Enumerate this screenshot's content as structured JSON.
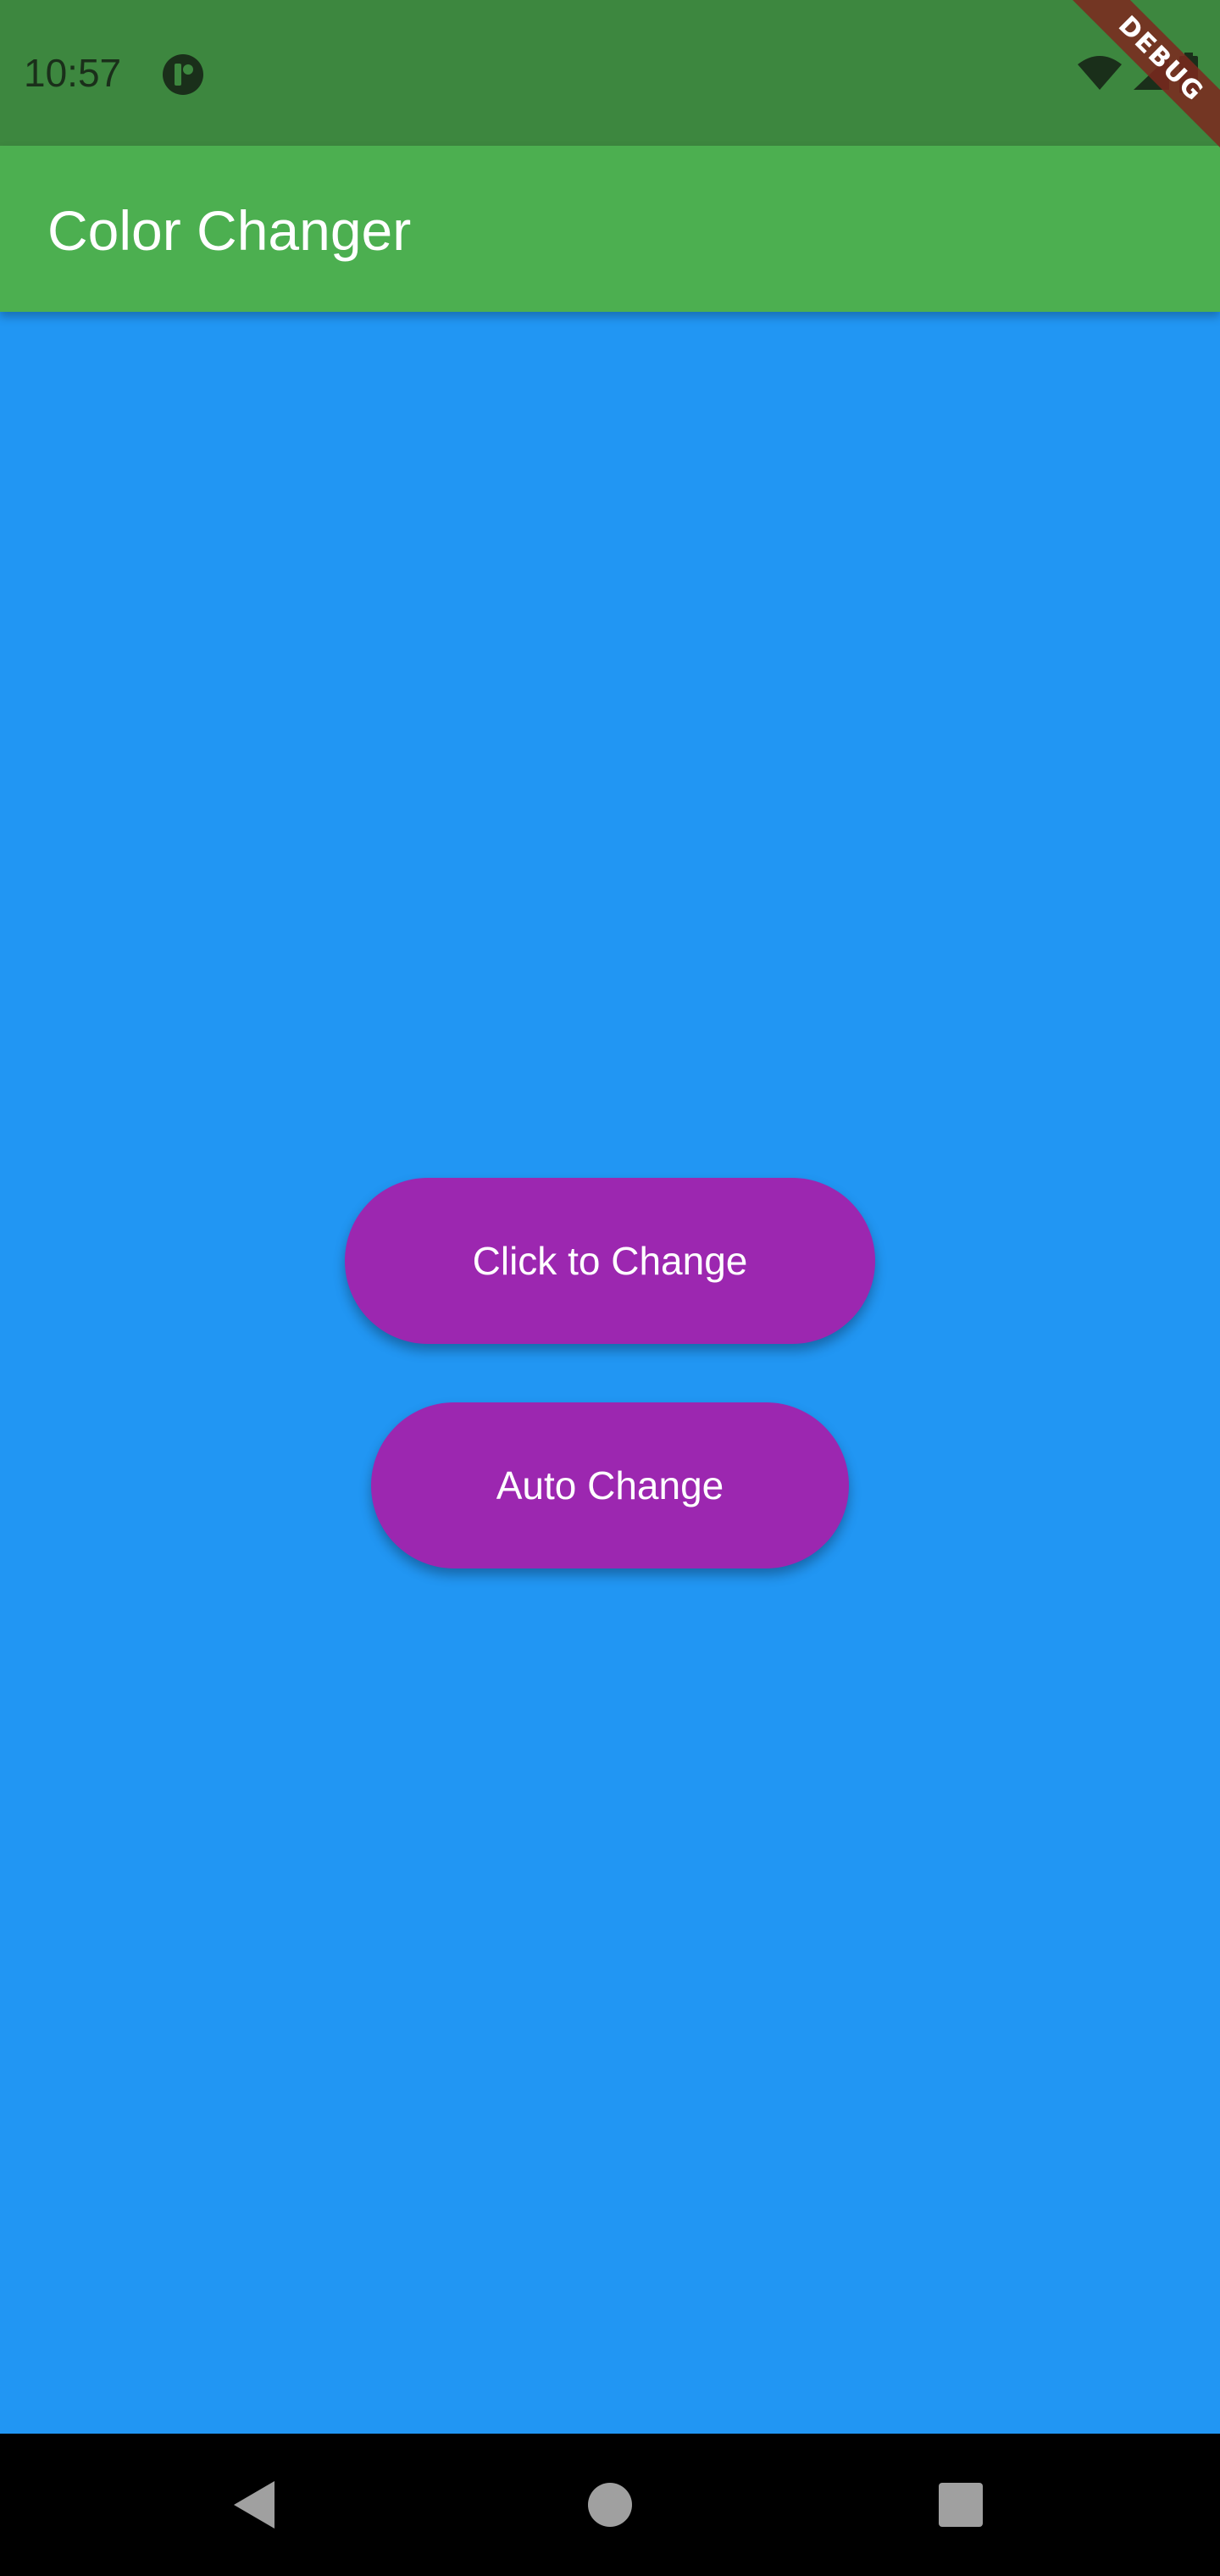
{
  "status_bar": {
    "time": "10:57",
    "icons": [
      "app-notification-icon",
      "wifi-icon",
      "signal-icon",
      "battery-icon"
    ]
  },
  "debug_banner": {
    "label": "DEBUG"
  },
  "app_bar": {
    "title": "Color Changer",
    "color": "#4CAF50"
  },
  "main": {
    "background_color": "#2196F3",
    "buttons": [
      {
        "label": "Click to Change",
        "color": "#9C27B0"
      },
      {
        "label": "Auto Change",
        "color": "#9C27B0"
      }
    ]
  },
  "nav_bar": {
    "items": [
      "back-icon",
      "home-icon",
      "recents-icon"
    ]
  }
}
